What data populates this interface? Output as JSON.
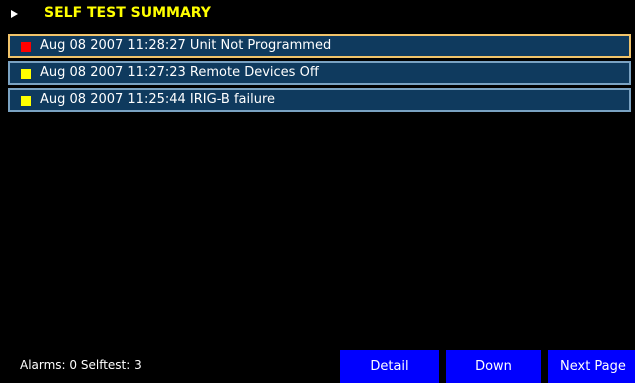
{
  "header": {
    "title": "SELF TEST SUMMARY",
    "icon": "arrow-right-icon"
  },
  "rows": [
    {
      "text": "Aug 08 2007 11:28:27 Unit Not Programmed",
      "severity_color": "#ff0000",
      "selected": true
    },
    {
      "text": "Aug 08 2007 11:27:23 Remote Devices Off",
      "severity_color": "#ffff00",
      "selected": false
    },
    {
      "text": "Aug 08 2007 11:25:44 IRIG-B failure",
      "severity_color": "#ffff00",
      "selected": false
    }
  ],
  "status": {
    "text": "Alarms: 0  Selftest: 3"
  },
  "buttons": {
    "detail": "Detail",
    "down": "Down",
    "next_page": "Next Page"
  },
  "colors": {
    "title": "#ffff00",
    "row_background": "#0f3a5e",
    "row_border": "#7aa2c2",
    "selected_border": "#f0c36a",
    "button": "#0000ff"
  }
}
